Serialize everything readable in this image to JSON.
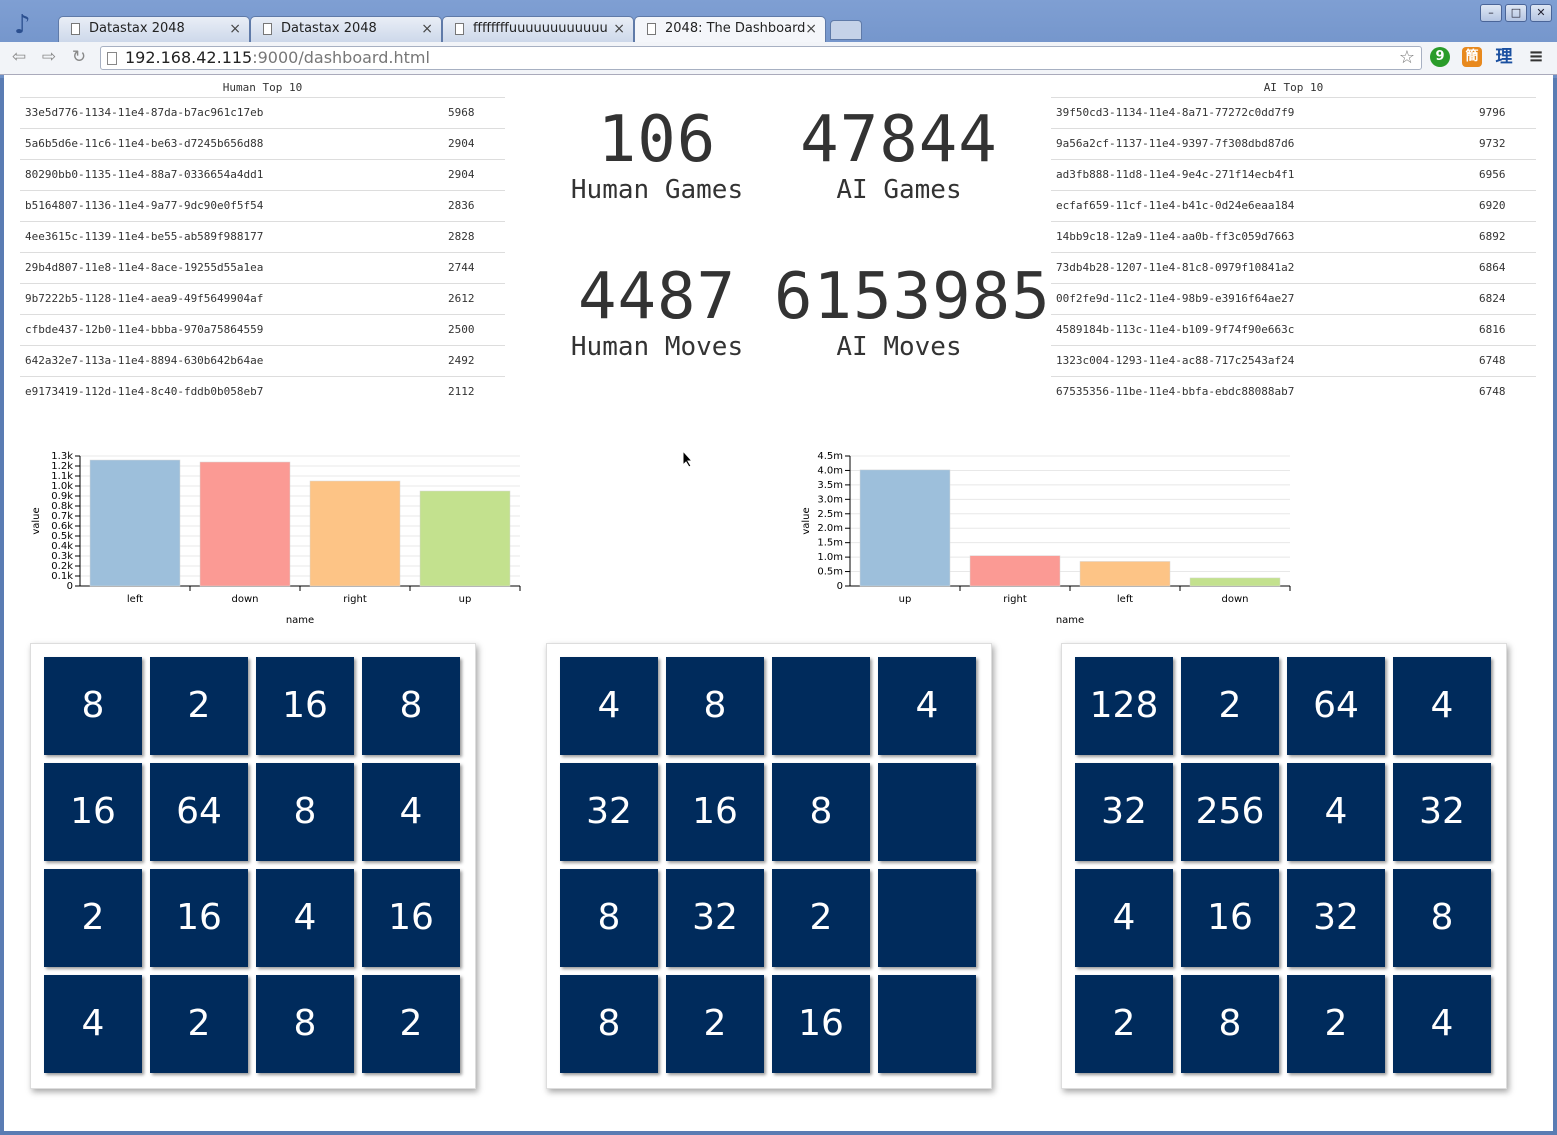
{
  "browser": {
    "tabs": [
      {
        "title": "Datastax 2048"
      },
      {
        "title": "Datastax 2048"
      },
      {
        "title": "ffffffffuuuuuuuuuuuu"
      },
      {
        "title": "2048: The Dashboard"
      }
    ],
    "close_glyph": "×",
    "url_host": "192.168.42.115",
    "url_rest": ":9000/dashboard.html",
    "ext_labels": [
      "9",
      "簡",
      "理"
    ]
  },
  "human_top": {
    "title": "Human Top 10",
    "rows": [
      {
        "id": "33e5d776-1134-11e4-87da-b7ac961c17eb",
        "score": "5968"
      },
      {
        "id": "5a6b5d6e-11c6-11e4-be63-d7245b656d88",
        "score": "2904"
      },
      {
        "id": "80290bb0-1135-11e4-88a7-0336654a4dd1",
        "score": "2904"
      },
      {
        "id": "b5164807-1136-11e4-9a77-9dc90e0f5f54",
        "score": "2836"
      },
      {
        "id": "4ee3615c-1139-11e4-be55-ab589f988177",
        "score": "2828"
      },
      {
        "id": "29b4d807-11e8-11e4-8ace-19255d55a1ea",
        "score": "2744"
      },
      {
        "id": "9b7222b5-1128-11e4-aea9-49f5649904af",
        "score": "2612"
      },
      {
        "id": "cfbde437-12b0-11e4-bbba-970a75864559",
        "score": "2500"
      },
      {
        "id": "642a32e7-113a-11e4-8894-630b642b64ae",
        "score": "2492"
      },
      {
        "id": "e9173419-112d-11e4-8c40-fddb0b058eb7",
        "score": "2112"
      }
    ]
  },
  "ai_top": {
    "title": "AI Top 10",
    "rows": [
      {
        "id": "39f50cd3-1134-11e4-8a71-77272c0dd7f9",
        "score": "9796"
      },
      {
        "id": "9a56a2cf-1137-11e4-9397-7f308dbd87d6",
        "score": "9732"
      },
      {
        "id": "ad3fb888-11d8-11e4-9e4c-271f14ecb4f1",
        "score": "6956"
      },
      {
        "id": "ecfaf659-11cf-11e4-b41c-0d24e6eaa184",
        "score": "6920"
      },
      {
        "id": "14bb9c18-12a9-11e4-aa0b-ff3c059d7663",
        "score": "6892"
      },
      {
        "id": "73db4b28-1207-11e4-81c8-0979f10841a2",
        "score": "6864"
      },
      {
        "id": "00f2fe9d-11c2-11e4-98b9-e3916f64ae27",
        "score": "6824"
      },
      {
        "id": "4589184b-113c-11e4-b109-9f74f90e663c",
        "score": "6816"
      },
      {
        "id": "1323c004-1293-11e4-ac88-717c2543af24",
        "score": "6748"
      },
      {
        "id": "67535356-11be-11e4-bbfa-ebdc88088ab7",
        "score": "6748"
      }
    ]
  },
  "stats": {
    "human_games": {
      "value": "106",
      "label": "Human Games"
    },
    "ai_games": {
      "value": "47844",
      "label": "AI Games"
    },
    "human_moves": {
      "value": "4487",
      "label": "Human Moves"
    },
    "ai_moves": {
      "value": "6153985",
      "label": "AI Moves"
    }
  },
  "chart_data": [
    {
      "type": "bar",
      "categories": [
        "left",
        "down",
        "right",
        "up"
      ],
      "values": [
        1260,
        1240,
        1050,
        950
      ],
      "colors": [
        "#9dbfdb",
        "#fb9a94",
        "#fdc486",
        "#c3e18e"
      ],
      "xlabel": "name",
      "ylabel": "value",
      "ylim": [
        0,
        1300
      ],
      "ticks": [
        0,
        100,
        200,
        300,
        400,
        500,
        600,
        700,
        800,
        900,
        1000,
        1100,
        1200,
        1300
      ],
      "tick_labels": [
        "0",
        "0.1k",
        "0.2k",
        "0.3k",
        "0.4k",
        "0.5k",
        "0.6k",
        "0.7k",
        "0.8k",
        "0.9k",
        "1.0k",
        "1.1k",
        "1.2k",
        "1.3k"
      ]
    },
    {
      "type": "bar",
      "categories": [
        "up",
        "right",
        "left",
        "down"
      ],
      "values": [
        4020000,
        1050000,
        850000,
        280000
      ],
      "colors": [
        "#9dbfdb",
        "#fb9a94",
        "#fdc486",
        "#c3e18e"
      ],
      "xlabel": "name",
      "ylabel": "value",
      "ylim": [
        0,
        4500000
      ],
      "ticks": [
        0,
        500000,
        1000000,
        1500000,
        2000000,
        2500000,
        3000000,
        3500000,
        4000000,
        4500000
      ],
      "tick_labels": [
        "0",
        "0.5m",
        "1.0m",
        "1.5m",
        "2.0m",
        "2.5m",
        "3.0m",
        "3.5m",
        "4.0m",
        "4.5m"
      ]
    }
  ],
  "boards": [
    [
      [
        "8",
        "2",
        "16",
        "8"
      ],
      [
        "16",
        "64",
        "8",
        "4"
      ],
      [
        "2",
        "16",
        "4",
        "16"
      ],
      [
        "4",
        "2",
        "8",
        "2"
      ]
    ],
    [
      [
        "4",
        "8",
        "",
        "4"
      ],
      [
        "32",
        "16",
        "8",
        ""
      ],
      [
        "8",
        "32",
        "2",
        ""
      ],
      [
        "8",
        "2",
        "16",
        ""
      ]
    ],
    [
      [
        "128",
        "2",
        "64",
        "4"
      ],
      [
        "32",
        "256",
        "4",
        "32"
      ],
      [
        "4",
        "16",
        "32",
        "8"
      ],
      [
        "2",
        "8",
        "2",
        "4"
      ]
    ]
  ]
}
